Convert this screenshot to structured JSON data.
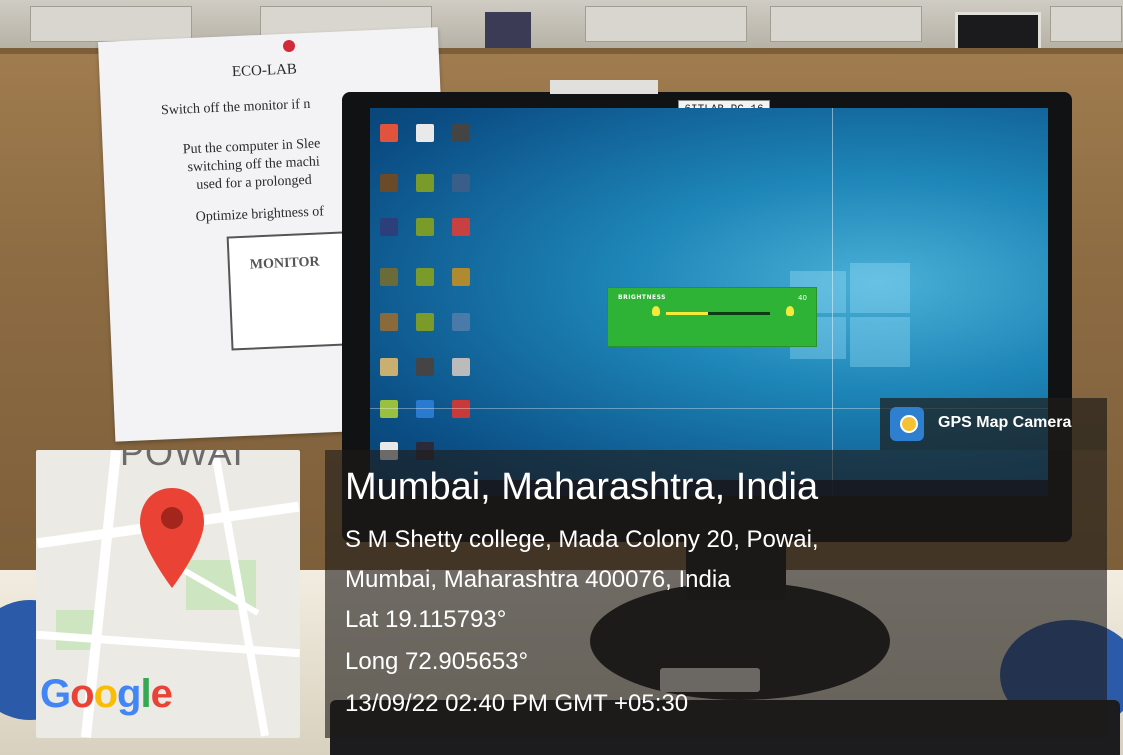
{
  "notice": {
    "title": "ECO-LAB",
    "line1": "Switch off the monitor if n",
    "line2": "Put the computer in Slee",
    "line3": "switching off the machi",
    "line4": "used for a prolonged",
    "line5": "Optimize brightness of",
    "figure_label": "MONITOR"
  },
  "monitor": {
    "pc_label": "6ITLAB-PC-16",
    "osd": {
      "title": "BRIGHTNESS",
      "value": "40",
      "level_fraction": 0.4
    }
  },
  "map": {
    "area_label": "POWAI",
    "brand": [
      "G",
      "o",
      "o",
      "g",
      "l",
      "e"
    ]
  },
  "gps_badge": {
    "label": "GPS Map Camera",
    "icon": "camera-pin-icon"
  },
  "location": {
    "title": "Mumbai, Maharashtra, India",
    "address_line1": "S M Shetty college, Mada Colony 20, Powai,",
    "address_line2": "Mumbai, Maharashtra 400076, India",
    "latitude": "Lat 19.115793°",
    "longitude": "Long 72.905653°",
    "datetime": "13/09/22 02:40 PM GMT +05:30"
  },
  "colors": {
    "overlay": "#1e1c18",
    "osd_green": "#2fb336",
    "pin_red": "#ea4335"
  }
}
